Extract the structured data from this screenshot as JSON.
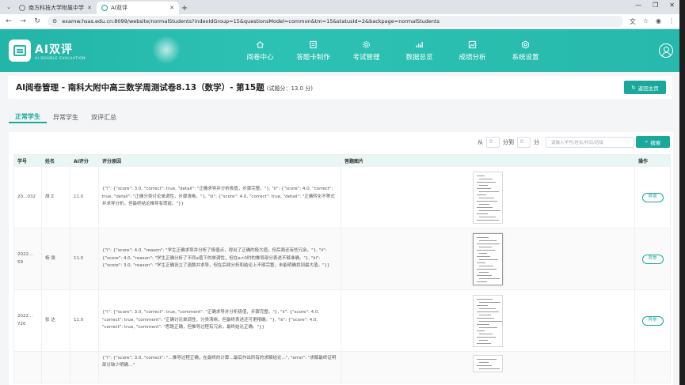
{
  "browser": {
    "tabs": [
      {
        "title": "南方科技大学附属中学",
        "active": false
      },
      {
        "title": "AI双评",
        "active": true
      }
    ],
    "url": "examw.hsas.edu.cn:8099/website/normalStudents?indexIdGroup=15&questionsModel=common&tm=15&statusId=2&backpage=normalStudents"
  },
  "header": {
    "logo_title": "AI双评",
    "logo_subtitle": "AI DOUBLE EVALUATION",
    "nav": [
      {
        "label": "阅卷中心",
        "icon": "home-icon"
      },
      {
        "label": "答题卡制作",
        "icon": "answer-sheet-icon"
      },
      {
        "label": "考试管理",
        "icon": "exam-gear-icon"
      },
      {
        "label": "数据总览",
        "icon": "bar-chart-icon"
      },
      {
        "label": "成绩分析",
        "icon": "analysis-icon"
      },
      {
        "label": "系统设置",
        "icon": "settings-icon"
      }
    ]
  },
  "page": {
    "title": "AI阅卷管理 - 南科大附中高三数学周测试卷8.13（数学）- 第15题",
    "score_note": "(试题分：13.0 分)",
    "back_label": "返回主页"
  },
  "subtabs": [
    {
      "label": "正常学生",
      "active": true
    },
    {
      "label": "异常学生",
      "active": false
    },
    {
      "label": "双评汇总",
      "active": false
    }
  ],
  "filter": {
    "from_label": "从",
    "from_value": "0",
    "to_label": "分到",
    "to_value": "0",
    "unit_label": "分",
    "search_placeholder": "请输入学号/姓名/科目/班级",
    "search_label": "搜索"
  },
  "table": {
    "headers": [
      "学号",
      "姓名",
      "AI评分",
      "评分原因",
      "答题图片",
      "操作"
    ],
    "rows": [
      {
        "id": "20…032",
        "name": "胡 Z",
        "score": "11.0",
        "reason": "{\"i\": {\"score\": 3.0, \"correct\": true, \"detail\": \"正确求导并分析极值，步骤完整。\"}, \"ii\": {\"score\": 4.0, \"correct\": true, \"detail\": \"正确分类讨论单调性，步骤清晰。\"}, \"iii\": {\"score\": 4.0, \"correct\": true, \"detail\": \"正确转化不等式并求导分析，但最终结论推导有瑕疵。\"}}",
        "action": "异常"
      },
      {
        "id": "2022…59",
        "name": "杨 强",
        "score": "11.0",
        "reason": "{\"i\": {\"score\": 4.0, \"reason\": \"学生正确求导并分析了极值点，得出了正确的极大值，但后面还有些冗余。\"}, \"ii\": {\"score\": 4.0, \"reason\": \"学生正确分析了不同a值下的单调性，但在a<0时的推导部分表述不够准确。\"}, \"iii\": {\"score\": 3.0, \"reason\": \"学生正确设立了函数并求导，但在后续分析和结论上不够完整，未能明确找到最大值。\"}}",
        "action": "异常"
      },
      {
        "id": "2022…720",
        "name": "张 达",
        "score": "11.0",
        "reason": "{\"i\": {\"score\": 3.0, \"correct\": true, \"comment\": \"正确求导并分析极值，步骤完整。\"}, \"ii\": {\"score\": 4.0, \"correct\": true, \"comment\": \"正确讨论单调性，分类清晰，但最终表述还可更精确。\"}, \"iii\": {\"score\": 4.0, \"correct\": true, \"comment\": \"思路正确，但推导过程有冗余，最终结论正确。\"}}",
        "action": "异常"
      },
      {
        "id": "",
        "name": "",
        "score": "",
        "reason": "{\"i\": {\"score\": 3.0, \"correct\": \"…推导过程正确，在最终的计算…最后作出所有的求解结论…\", \"error\": \"求解最终证明部分缺少明确…\"",
        "action": ""
      }
    ]
  }
}
